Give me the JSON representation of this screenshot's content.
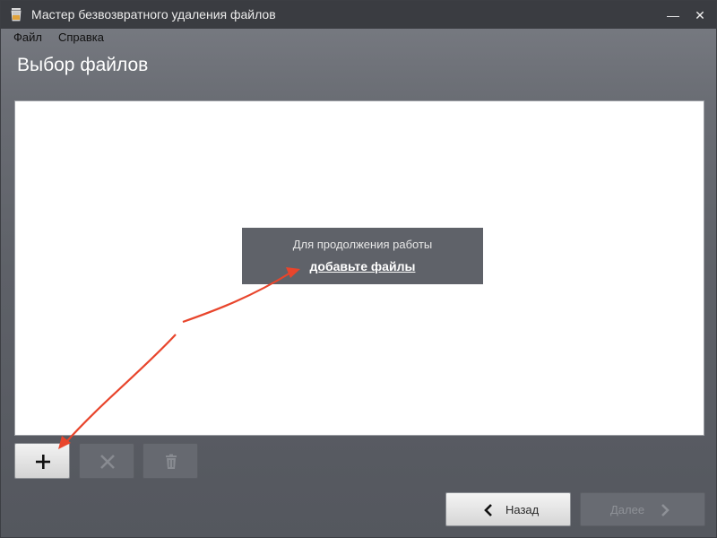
{
  "window": {
    "title": "Мастер безвозвратного удаления файлов",
    "minimize_glyph": "—",
    "close_glyph": "✕"
  },
  "menu": {
    "file": "Файл",
    "help": "Справка"
  },
  "page": {
    "title": "Выбор файлов"
  },
  "file_list": {
    "hint_text": "Для продолжения работы",
    "hint_link": "добавьте файлы"
  },
  "toolbar": {
    "add_icon": "plus-icon",
    "remove_icon": "x-icon",
    "delete_icon": "trash-icon",
    "remove_enabled": false,
    "delete_enabled": false
  },
  "navigation": {
    "back_label": "Назад",
    "next_label": "Далее",
    "next_enabled": false
  },
  "colors": {
    "annotation_arrow": "#e8452c",
    "titlebar": "#3a3c41",
    "hint_box": "#5f6269"
  }
}
